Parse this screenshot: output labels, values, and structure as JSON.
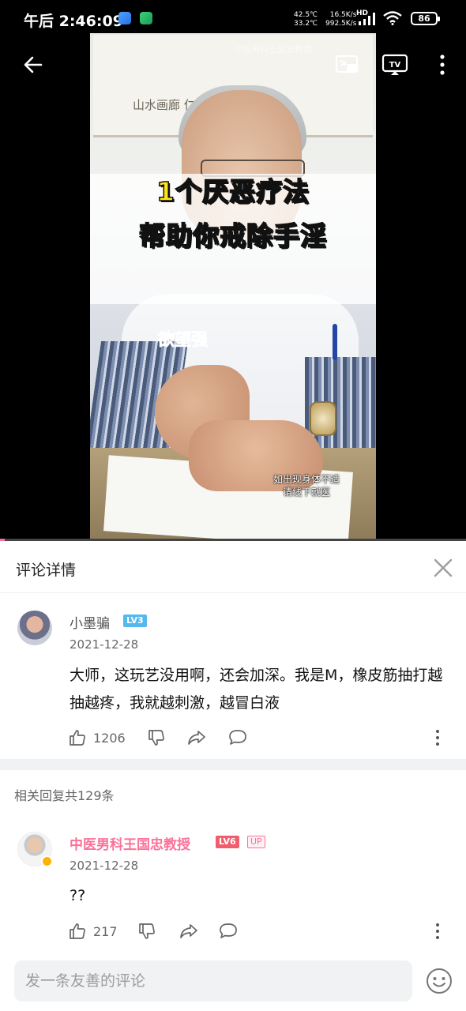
{
  "status_bar": {
    "time": "午后 2:46:09",
    "temp_1": "42.5℃",
    "temp_2": "33.2℃",
    "speed_1": "16.5K/s",
    "speed_2": "992.5K/s",
    "network": "HD",
    "battery": "86"
  },
  "video": {
    "watermark": "中医男科王国忠教授",
    "title_line_1": "1个厌恶疗法",
    "title_line_2": "帮助你戒除手淫",
    "caption_tag": "欲望强",
    "calligraphy": "山水画廊 仁心仁术 妙手回春",
    "disclaimer_line_1": "如出现身体不适",
    "disclaimer_line_2": "请线下就医",
    "progress": 0.01,
    "icons": {
      "back": "back-arrow-icon",
      "pip": "picture-in-picture-icon",
      "tv": "tv-cast-icon",
      "more": "more-vertical-icon"
    }
  },
  "panel": {
    "title": "评论详情",
    "close_icon": "close-icon"
  },
  "main_comment": {
    "username": "小墨骗",
    "level": "LV3",
    "date": "2021-12-28",
    "text": "大师，这玩艺没用啊，还会加深。我是M，橡皮筋抽打越抽越疼，我就越刺激，越冒白液",
    "likes": "1206"
  },
  "replies_heading": "相关回复共129条",
  "reply": {
    "username": "中医男科王国忠教授",
    "level": "LV6",
    "up_badge": "UP",
    "date": "2021-12-28",
    "text": "??",
    "likes": "217"
  },
  "input": {
    "placeholder": "发一条友善的评论"
  },
  "colors": {
    "accent_pink": "#fb7299",
    "level_blue": "#55b9ee",
    "level_red": "#f25d6e"
  }
}
